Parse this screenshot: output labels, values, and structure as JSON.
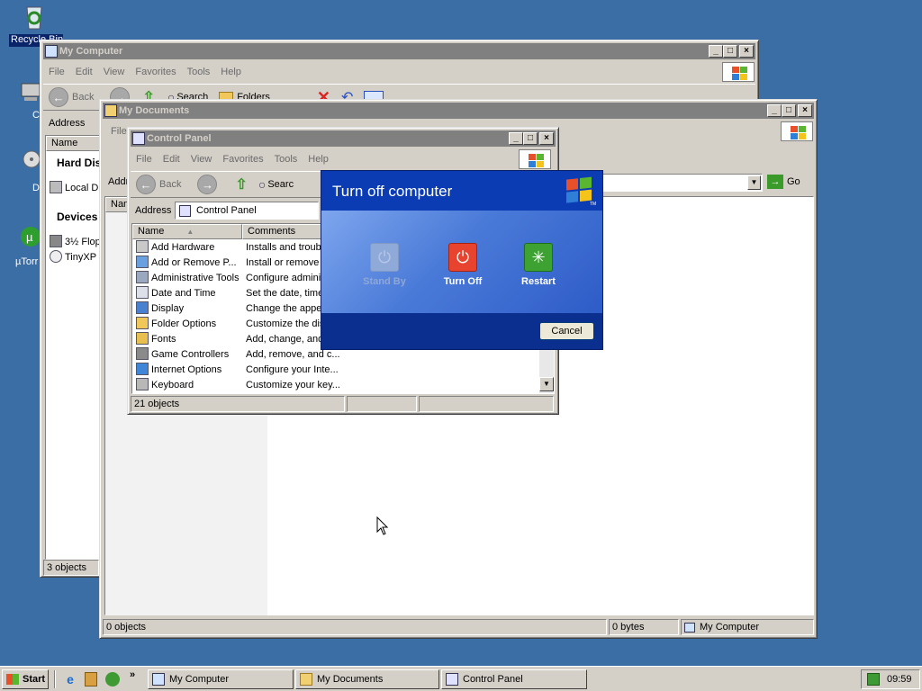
{
  "desktop": {
    "recycle_label": "Recycle Bin",
    "left_labels": [
      "C",
      "D",
      "µTorr"
    ]
  },
  "mycomputer": {
    "title": "My Computer",
    "menu": [
      "File",
      "Edit",
      "View",
      "Favorites",
      "Tools",
      "Help"
    ],
    "toolbar": {
      "back": "Back",
      "search": "Search",
      "folders": "Folders"
    },
    "address_label": "Address",
    "col_name": "Name",
    "groups": [
      "Hard Dis",
      "Devices"
    ],
    "items": [
      "Local Dis",
      "3½ Flop",
      "TinyXP ("
    ],
    "status": "3 objects"
  },
  "mydocuments": {
    "title": "My Documents",
    "menu_first": "File",
    "address_label": "Addr",
    "go_label": "Go",
    "col_name": "Nam",
    "status": {
      "objects": "0 objects",
      "size": "0 bytes",
      "location": "My Computer"
    }
  },
  "controlpanel": {
    "title": "Control Panel",
    "menu": [
      "File",
      "Edit",
      "View",
      "Favorites",
      "Tools",
      "Help"
    ],
    "toolbar": {
      "back": "Back",
      "search": "Searc"
    },
    "address_label": "Address",
    "address_value": "Control Panel",
    "columns": {
      "name": "Name",
      "comments": "Comments"
    },
    "rows": [
      {
        "name": "Add Hardware",
        "comment": "Installs and troub"
      },
      {
        "name": "Add or Remove P...",
        "comment": "Install or remove"
      },
      {
        "name": "Administrative Tools",
        "comment": "Configure adminis"
      },
      {
        "name": "Date and Time",
        "comment": "Set the date, time"
      },
      {
        "name": "Display",
        "comment": "Change the appe"
      },
      {
        "name": "Folder Options",
        "comment": "Customize the dis"
      },
      {
        "name": "Fonts",
        "comment": "Add, change, and"
      },
      {
        "name": "Game Controllers",
        "comment": "Add, remove, and c..."
      },
      {
        "name": "Internet Options",
        "comment": "Configure your Inte..."
      },
      {
        "name": "Keyboard",
        "comment": "Customize your key..."
      }
    ],
    "status": "21 objects"
  },
  "dialog": {
    "title": "Turn off computer",
    "buttons": {
      "standby": "Stand By",
      "turnoff": "Turn Off",
      "restart": "Restart"
    },
    "cancel": "Cancel",
    "tm": "TM"
  },
  "taskbar": {
    "start": "Start",
    "tasks": [
      "My Computer",
      "My Documents",
      "Control Panel"
    ],
    "clock": "09:59"
  }
}
